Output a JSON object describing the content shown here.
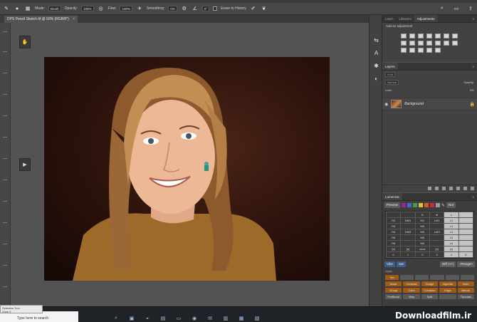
{
  "optionsBar": {
    "mode_label": "Mode:",
    "mode_value": "Brush",
    "opacity_label": "Opacity:",
    "opacity_value": "100%",
    "flow_label": "Flow:",
    "flow_value": "100%",
    "smoothing_label": "Smoothing:",
    "smoothing_value": "0%",
    "angle_value": "0°",
    "erase_history_label": "Erase to History"
  },
  "document": {
    "tab_label": "DPS Pencil Sketch.tif @ 50% (RGB/8*)",
    "close_glyph": "×"
  },
  "panels": {
    "tabs": [
      "Learn",
      "Libraries",
      "Adjustments"
    ],
    "add_adjustment_label": "Add an adjustment"
  },
  "layers": {
    "panel_title": "Layers",
    "kind_placeholder": "Kind",
    "blend_mode": "Normal",
    "opacity_label": "Opacity:",
    "lock_label": "Lock:",
    "fill_label": "Fill:",
    "background_layer_name": "Background"
  },
  "lumenzia": {
    "title": "Lumenzia",
    "preview_label": "Preview",
    "not_label": "Not",
    "grid_rows": [
      [
        "",
        "",
        "D",
        "M",
        "L",
        ""
      ],
      [
        "D2",
        "DM1",
        "M1",
        "LM1",
        "L2",
        ""
      ],
      [
        "D3",
        "",
        "M3",
        "",
        "L3",
        ""
      ],
      [
        "D4",
        "DM3",
        "M3",
        "LM3",
        "L4",
        ""
      ],
      [
        "D5",
        "",
        "M5",
        "",
        "L5",
        ""
      ],
      [
        "D6",
        "",
        "M6",
        "",
        "L6",
        ""
      ],
      [
        "[z]",
        "[z]",
        "zone",
        "[z]",
        "[z]",
        ""
      ],
      [
        "0",
        "1",
        "2",
        "3",
        "4",
        "5"
      ]
    ],
    "vibe_label": "Vibe",
    "sat_label": "Sat",
    "diff_label": "Diff (+/-)",
    "range_label": "<Range>",
    "apply_label": "Apply",
    "row1": [
      "Sel",
      "",
      "",
      "",
      "",
      ""
    ],
    "row2": [
      "Mask",
      "Contrast",
      "Dodge",
      "Vignette",
      "Burn"
    ],
    "row3": [
      "Group",
      "Color",
      "Combine",
      "Edge",
      "Before"
    ],
    "row4": [
      "PreBlend",
      "Map",
      "Split",
      "",
      "Tutorials"
    ]
  },
  "status": {
    "zoom_doc": "Doc: 22.9M/30.8M"
  },
  "notice": {
    "title": "Selective Tool",
    "line": "Zone 2"
  },
  "taskbar": {
    "search_placeholder": "Type here to search"
  },
  "watermark": {
    "text": "Downloadfilm.ir"
  }
}
